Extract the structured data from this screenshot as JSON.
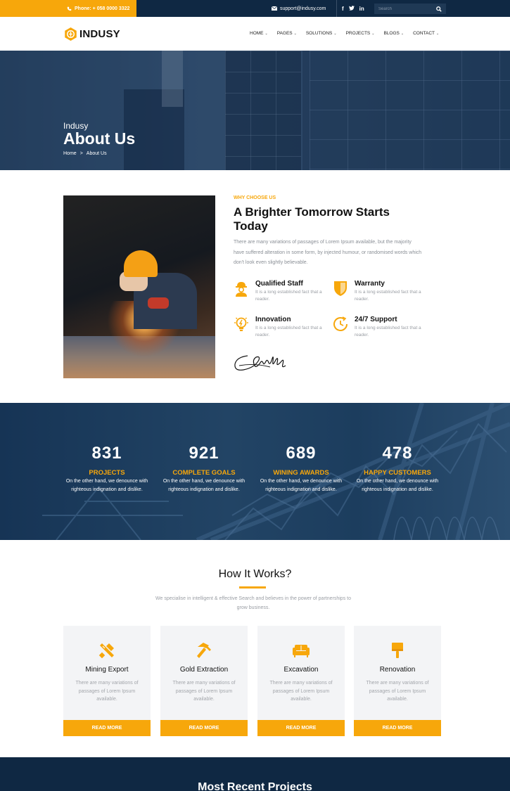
{
  "topbar": {
    "phone": "Phone: + 058 0000 3322",
    "email": "support@indusy.com",
    "social": [
      "f",
      "t",
      "in"
    ],
    "search_placeholder": "Search"
  },
  "header": {
    "logo": "INDUSY",
    "nav": [
      "HOME",
      "PAGES",
      "SOLUTIONS",
      "PROJECTS",
      "BLOGS",
      "CONTACT"
    ]
  },
  "hero": {
    "subtitle": "Indusy",
    "title": "About Us",
    "breadcrumb": [
      "Home",
      "About Us"
    ],
    "breadcrumb_sep": ">"
  },
  "why": {
    "label": "WHY CHOOSE US",
    "title": "A Brighter Tomorrow Starts Today",
    "text": "There are many variations of passages of Lorem Ipsum available, but the majority have suffered alteration in some form, by injected humour, or randomised words which don't look even slightly believable.",
    "features": [
      {
        "name": "Qualified Staff",
        "desc": "It is a long established fact that a reader.",
        "icon": "worker-icon"
      },
      {
        "name": "Warranty",
        "desc": "It is a long established fact that a reader.",
        "icon": "shield-icon"
      },
      {
        "name": "Innovation",
        "desc": "It is a long established fact that a reader.",
        "icon": "lightbulb-icon"
      },
      {
        "name": "24/7 Support",
        "desc": "It is a long established fact that a reader.",
        "icon": "clock-icon"
      }
    ]
  },
  "counters": [
    {
      "number": "831",
      "label": "PROJECTS",
      "desc": "On the other hand, we denounce with righteous indignation and dislike."
    },
    {
      "number": "921",
      "label": "COMPLETE GOALS",
      "desc": "On the other hand, we denounce with righteous indignation and dislike."
    },
    {
      "number": "689",
      "label": "WINING AWARDS",
      "desc": "On the other hand, we denounce with righteous indignation and dislike."
    },
    {
      "number": "478",
      "label": "HAPPY CUSTOMERS",
      "desc": "On the other hand, we denounce with righteous indignation and dislike."
    }
  ],
  "how": {
    "title": "How It Works?",
    "text": "We specialise in intelligent & effective Search and believes in the power of partnerships to grow business.",
    "cards": [
      {
        "title": "Mining Export",
        "text": "There are many variations of passages of Lorem Ipsum available.",
        "button": "READ MORE",
        "icon": "tools-icon"
      },
      {
        "title": "Gold Extraction",
        "text": "There are many variations of passages of Lorem Ipsum available.",
        "button": "READ MORE",
        "icon": "hammer-icon"
      },
      {
        "title": "Excavation",
        "text": "There are many variations of passages of Lorem Ipsum available.",
        "button": "READ MORE",
        "icon": "sofa-icon"
      },
      {
        "title": "Renovation",
        "text": "There are many variations of passages of Lorem Ipsum available.",
        "button": "READ MORE",
        "icon": "paint-brush-icon"
      }
    ]
  },
  "recent": {
    "title": "Most Recent Projects"
  },
  "colors": {
    "accent": "#f7a70b",
    "navy": "#0f2843"
  }
}
